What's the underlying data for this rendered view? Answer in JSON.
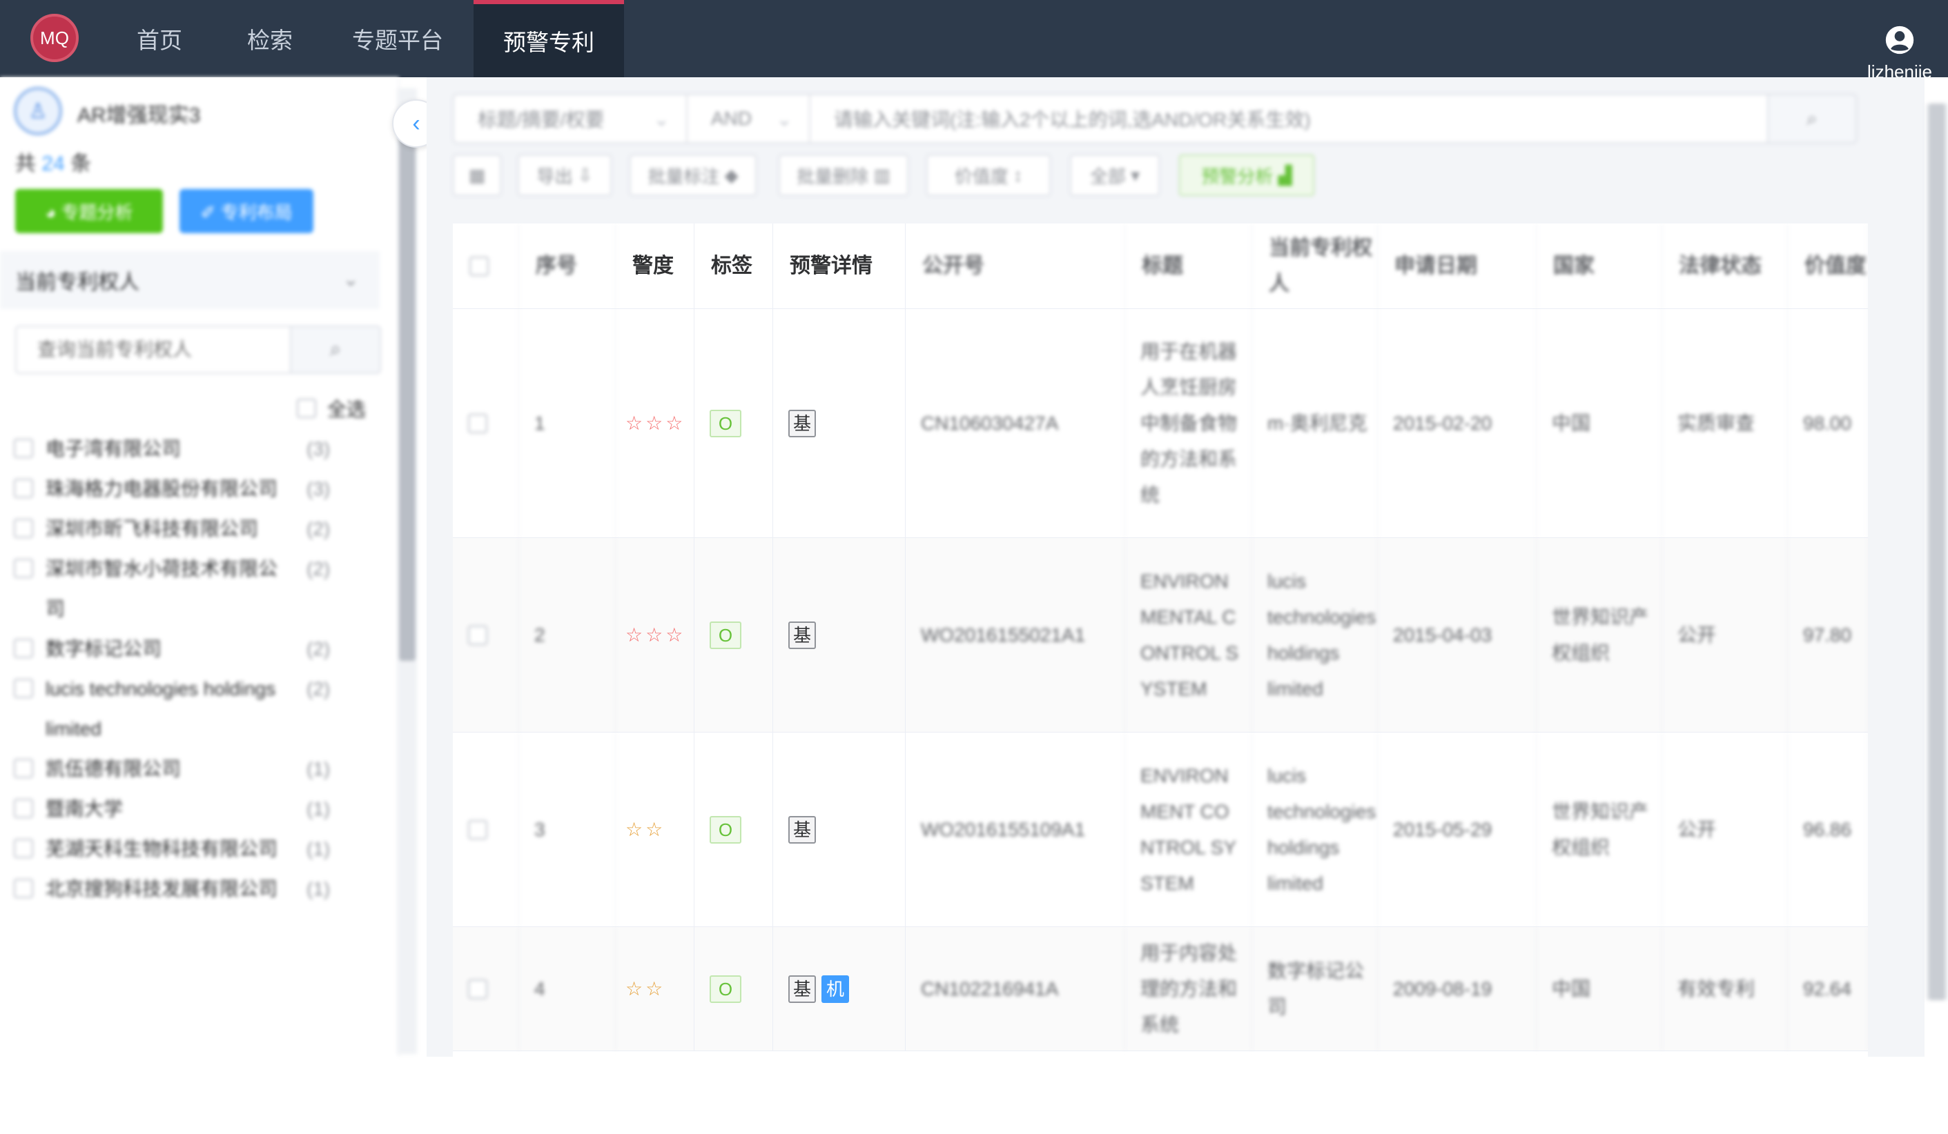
{
  "nav": {
    "logo": "MQ",
    "items": [
      {
        "label": "首页"
      },
      {
        "label": "检索"
      },
      {
        "label": "专题平台"
      },
      {
        "label": "预警专利"
      }
    ],
    "user": "lizhenjie"
  },
  "sidebar": {
    "project_name": "AR增强现实3",
    "count_prefix": "共",
    "count": "24",
    "count_suffix": "条",
    "btn_analysis": "◕ 专题分析",
    "btn_layout": "✐ 专利布局",
    "section_title": "当前专利权人",
    "search_placeholder": "查询当前专利权人",
    "select_all": "全选",
    "assignees": [
      {
        "name": "电子湾有限公司",
        "count": "(3)"
      },
      {
        "name": "珠海格力电器股份有限公司",
        "count": "(3)"
      },
      {
        "name": "深圳市昕飞科技有限公司",
        "count": "(2)"
      },
      {
        "name": "深圳市智水小荷技术有限公司",
        "count": "(2)"
      },
      {
        "name": "数字标记公司",
        "count": "(2)"
      },
      {
        "name": "lucis technologies holdings limited",
        "count": "(2)"
      },
      {
        "name": "凯伍德有限公司",
        "count": "(1)"
      },
      {
        "name": "暨南大学",
        "count": "(1)"
      },
      {
        "name": "芜湖天科生物科技有限公司",
        "count": "(1)"
      },
      {
        "name": "北京搜狗科技发展有限公司",
        "count": "(1)"
      }
    ]
  },
  "search": {
    "field": "标题/摘要/权要",
    "operator": "AND",
    "placeholder": "请输入关键词(注:输入2个以上的词,选AND/OR关系生效)"
  },
  "toolbar": {
    "export": "导出",
    "batch_tag": "批量标注",
    "batch_delete": "批量删除",
    "value": "价值度",
    "all": "全部",
    "warn_analysis": "预警分析"
  },
  "table": {
    "headers": [
      "序号",
      "警度",
      "标签",
      "预警详情",
      "公开号",
      "标题",
      "当前专利权人",
      "申请日期",
      "国家",
      "法律状态",
      "价值度"
    ],
    "rows": [
      {
        "no": "1",
        "stars": "☆☆☆",
        "tag": "O",
        "details": [
          "基"
        ],
        "pub": "CN106030427A",
        "title": "用于在机器人烹饪厨房中制备食物的方法和系统",
        "assignee": "m·奥利尼克",
        "date": "2015-02-20",
        "country": "中国",
        "status": "实质审查",
        "value": "98.00"
      },
      {
        "no": "2",
        "stars": "☆☆☆",
        "tag": "O",
        "details": [
          "基"
        ],
        "pub": "WO2016155021A1",
        "title": "ENVIRONMENTAL CONTROL SYSTEM",
        "assignee": "lucis technologies holdings limited",
        "date": "2015-04-03",
        "country": "世界知识产权组织",
        "status": "公开",
        "value": "97.80"
      },
      {
        "no": "3",
        "stars": "☆☆",
        "tag": "O",
        "details": [
          "基"
        ],
        "pub": "WO2016155109A1",
        "title": "ENVIRONMENT CONTROL SYSTEM",
        "assignee": "lucis technologies holdings limited",
        "date": "2015-05-29",
        "country": "世界知识产权组织",
        "status": "公开",
        "value": "96.86"
      },
      {
        "no": "4",
        "stars": "☆☆",
        "tag": "O",
        "details": [
          "基",
          "机"
        ],
        "pub": "CN102216941A",
        "title": "用于内容处理的方法和系统",
        "assignee": "数字标记公司",
        "date": "2009-08-19",
        "country": "中国",
        "status": "有效专利",
        "value": "92.64"
      }
    ]
  },
  "colors": {
    "nav_bg": "#2d3a4b",
    "accent": "#d23b5b",
    "primary": "#409eff",
    "success": "#52c41a",
    "star_red": "#f56c6c",
    "star_orange": "#e6a23c"
  }
}
